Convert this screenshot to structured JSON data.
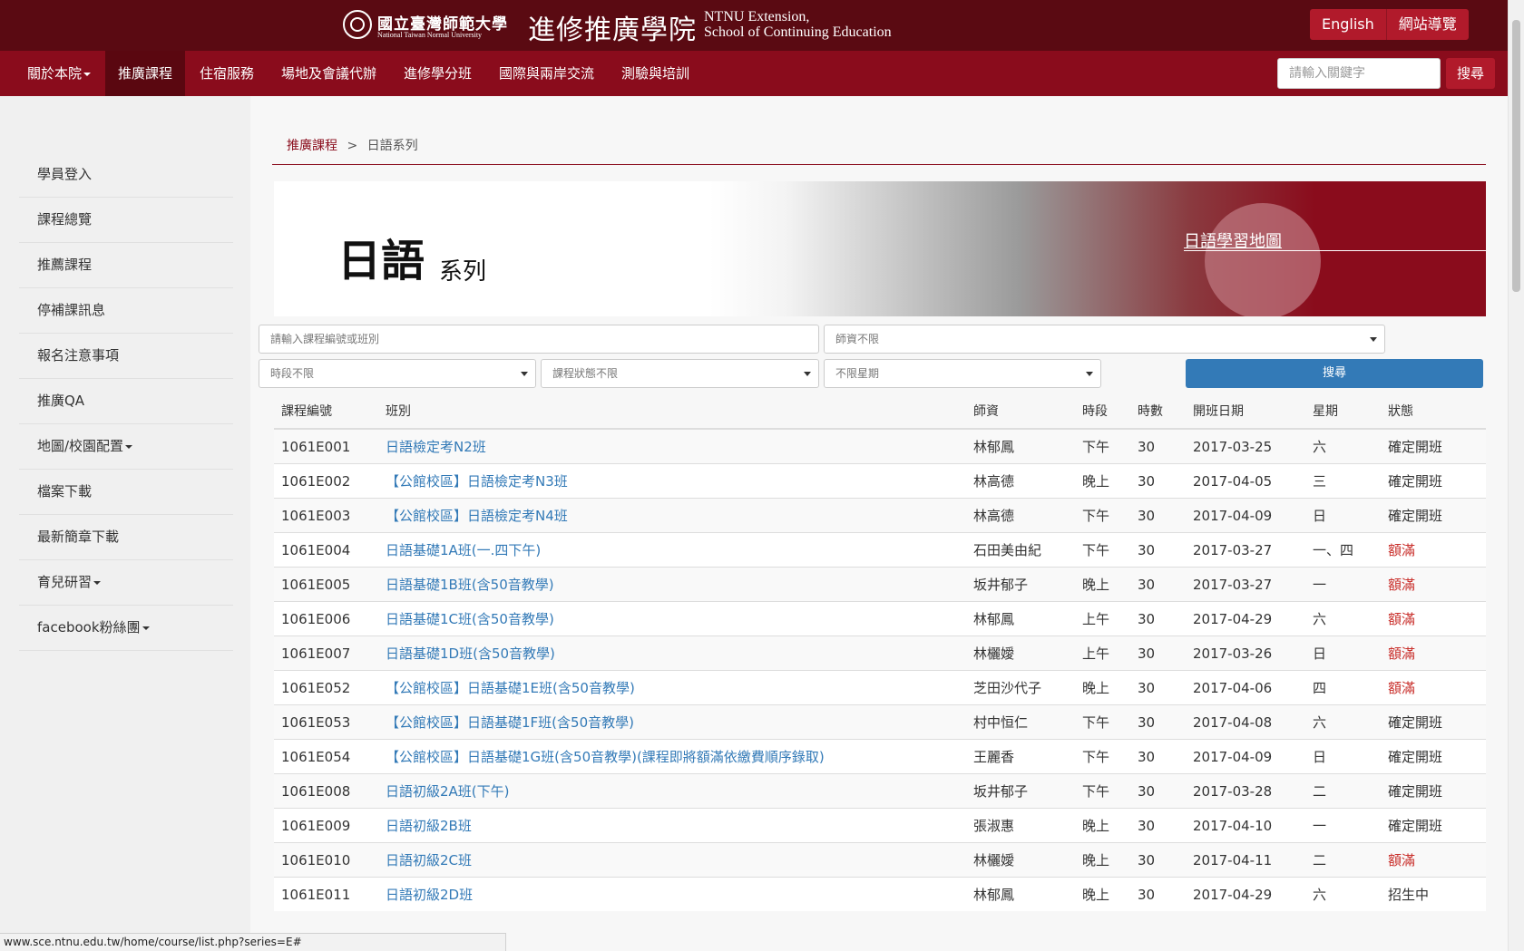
{
  "header": {
    "university_zh": "國立臺灣師範大學",
    "university_en": "National Taiwan Normal University",
    "school_zh": "進修推廣學院",
    "school_en_line1": "NTNU Extension,",
    "school_en_line2": "School of Continuing Education",
    "english_label": "English",
    "sitemap_label": "網站導覽"
  },
  "nav": {
    "items": [
      "關於本院",
      "推廣課程",
      "住宿服務",
      "場地及會議代辦",
      "進修學分班",
      "國際與兩岸交流",
      "測驗與培訓"
    ],
    "search_placeholder": "請輸入關鍵字",
    "search_button": "搜尋"
  },
  "sidebar": {
    "items": [
      "學員登入",
      "課程總覽",
      "推薦課程",
      "停補課訊息",
      "報名注意事項",
      "推廣QA",
      "地圖/校園配置",
      "檔案下載",
      "最新簡章下載",
      "育兒研習",
      "facebook粉絲團"
    ]
  },
  "breadcrumb": {
    "parent": "推廣課程",
    "separator": ">",
    "current": "日語系列"
  },
  "banner": {
    "title": "日語",
    "subtitle": "系列",
    "link": "日語學習地圖"
  },
  "filters": {
    "keyword_placeholder": "請輸入課程編號或班別",
    "teacher": "師資不限",
    "period": "時段不限",
    "status": "課程狀態不限",
    "weekday": "不限星期",
    "search_button": "搜尋"
  },
  "table": {
    "headers": [
      "課程編號",
      "班別",
      "師資",
      "時段",
      "時數",
      "開班日期",
      "星期",
      "狀態"
    ],
    "rows": [
      [
        "1061E001",
        "日語檢定考N2班",
        "林郁鳳",
        "下午",
        "30",
        "2017-03-25",
        "六",
        "確定開班"
      ],
      [
        "1061E002",
        "【公館校區】日語檢定考N3班",
        "林高德",
        "晚上",
        "30",
        "2017-04-05",
        "三",
        "確定開班"
      ],
      [
        "1061E003",
        "【公館校區】日語檢定考N4班",
        "林高德",
        "下午",
        "30",
        "2017-04-09",
        "日",
        "確定開班"
      ],
      [
        "1061E004",
        "日語基礎1A班(一.四下午)",
        "石田美由紀",
        "下午",
        "30",
        "2017-03-27",
        "一、四",
        "額滿"
      ],
      [
        "1061E005",
        "日語基礎1B班(含50音教學)",
        "坂井郁子",
        "晚上",
        "30",
        "2017-03-27",
        "一",
        "額滿"
      ],
      [
        "1061E006",
        "日語基礎1C班(含50音教學)",
        "林郁鳳",
        "上午",
        "30",
        "2017-04-29",
        "六",
        "額滿"
      ],
      [
        "1061E007",
        "日語基礎1D班(含50音教學)",
        "林欐嬡",
        "上午",
        "30",
        "2017-03-26",
        "日",
        "額滿"
      ],
      [
        "1061E052",
        "【公館校區】日語基礎1E班(含50音教學)",
        "芝田沙代子",
        "晚上",
        "30",
        "2017-04-06",
        "四",
        "額滿"
      ],
      [
        "1061E053",
        "【公館校區】日語基礎1F班(含50音教學)",
        "村中恒仁",
        "下午",
        "30",
        "2017-04-08",
        "六",
        "確定開班"
      ],
      [
        "1061E054",
        "【公館校區】日語基礎1G班(含50音教學)(課程即將額滿依繳費順序錄取)",
        "王麗香",
        "下午",
        "30",
        "2017-04-09",
        "日",
        "確定開班"
      ],
      [
        "1061E008",
        "日語初級2A班(下午)",
        "坂井郁子",
        "下午",
        "30",
        "2017-03-28",
        "二",
        "確定開班"
      ],
      [
        "1061E009",
        "日語初級2B班",
        "張淑惠",
        "晚上",
        "30",
        "2017-04-10",
        "一",
        "確定開班"
      ],
      [
        "1061E010",
        "日語初級2C班",
        "林欐嬡",
        "晚上",
        "30",
        "2017-04-11",
        "二",
        "額滿"
      ],
      [
        "1061E011",
        "日語初級2D班",
        "林郁鳳",
        "晚上",
        "30",
        "2017-04-29",
        "六",
        "招生中"
      ]
    ]
  },
  "statusbar": {
    "url": "www.sce.ntnu.edu.tw/home/course/list.php?series=E#"
  },
  "colors": {
    "header_bg": "#5a0a12",
    "nav_bg": "#8a0c1c",
    "accent": "#b11a2b",
    "link": "#337ab7",
    "full": "#c9302c"
  }
}
